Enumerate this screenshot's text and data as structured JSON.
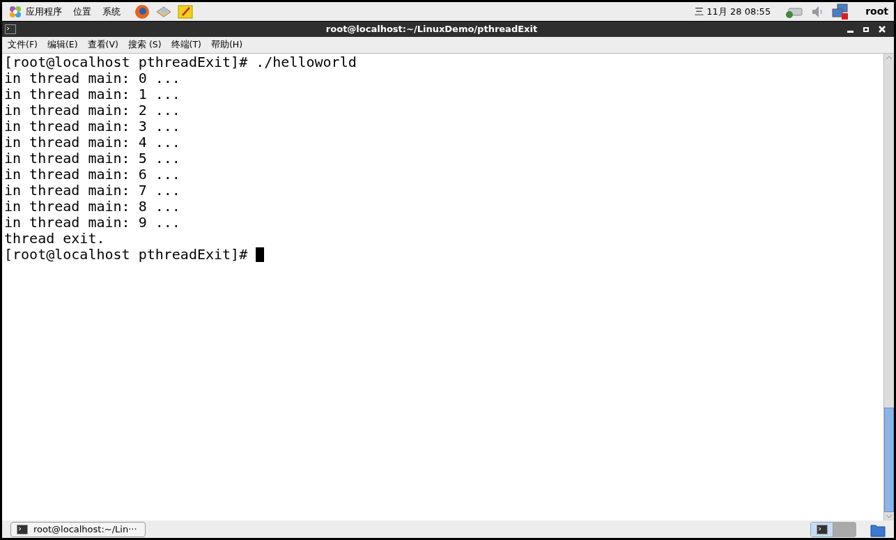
{
  "top_panel": {
    "menus": [
      "应用程序",
      "位置",
      "系统"
    ],
    "clock": "三 11月 28 08:55",
    "user": "root"
  },
  "window": {
    "title": "root@localhost:~/LinuxDemo/pthreadExit"
  },
  "menu_bar": [
    "文件(F)",
    "编辑(E)",
    "查看(V)",
    "搜索 (S)",
    "终端(T)",
    "帮助(H)"
  ],
  "terminal": {
    "lines": [
      "[root@localhost pthreadExit]# ./helloworld",
      "in thread main: 0 ...",
      "in thread main: 1 ...",
      "in thread main: 2 ...",
      "in thread main: 3 ...",
      "in thread main: 4 ...",
      "in thread main: 5 ...",
      "in thread main: 6 ...",
      "in thread main: 7 ...",
      "in thread main: 8 ...",
      "in thread main: 9 ...",
      "thread exit.",
      "[root@localhost pthreadExit]# "
    ],
    "cursor": true
  },
  "taskbar": {
    "items": [
      {
        "label": "root@localhost:~/Lin···",
        "selected": false
      }
    ],
    "workspaces": [
      {
        "selected": true
      },
      {
        "selected": false
      }
    ]
  }
}
